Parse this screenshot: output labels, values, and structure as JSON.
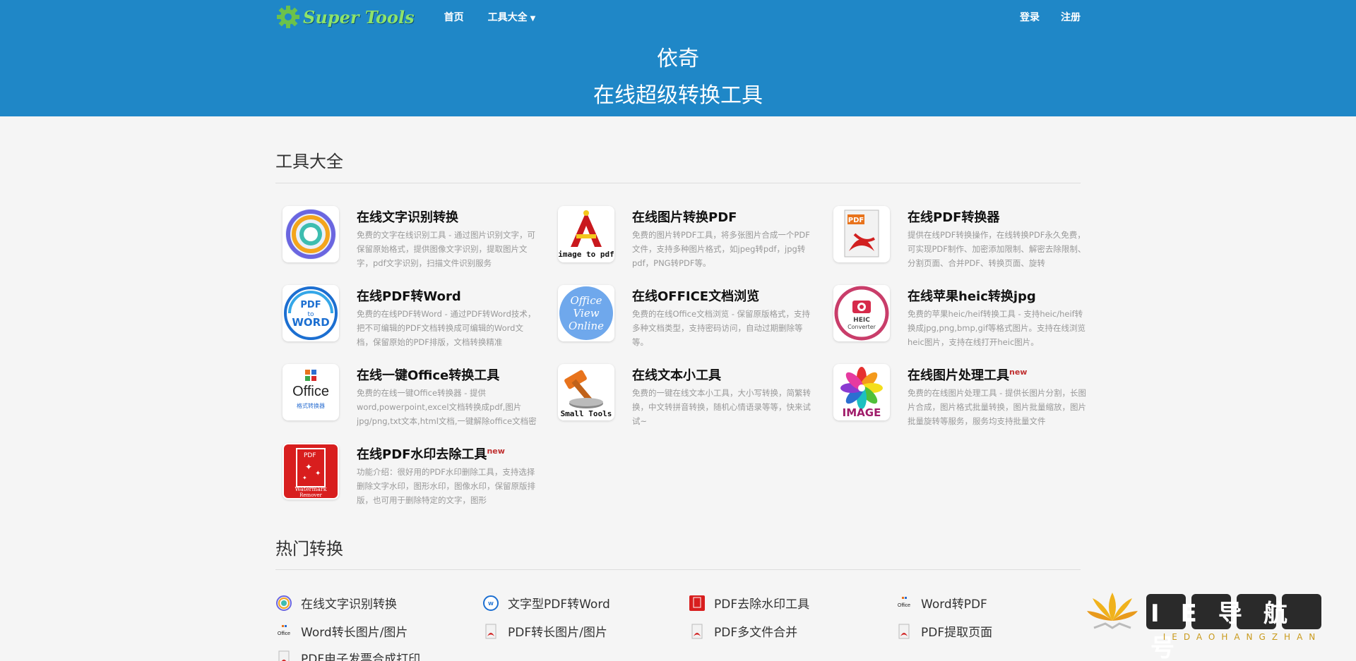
{
  "nav": {
    "brand": "Super Tools",
    "home": "首页",
    "tools_menu": "工具大全",
    "login": "登录",
    "register": "注册"
  },
  "hero": {
    "line1": "依奇",
    "line2": "在线超级转换工具"
  },
  "tools_section": {
    "title": "工具大全",
    "items": [
      {
        "title": "在线文字识别转换",
        "new": "",
        "icon": "ocr-icon",
        "desc": "免费的文字在线识别工具 - 通过图片识别文字，可保留原始格式，提供图像文字识别，提取图片文字，pdf文字识别，扫描文件识别服务"
      },
      {
        "title": "在线图片转换PDF",
        "new": "",
        "icon": "image-to-pdf-icon",
        "desc": "免费的图片转PDF工具，将多张图片合成一个PDF文件，支持多种图片格式，如jpeg转pdf，jpg转pdf，PNG转PDF等。"
      },
      {
        "title": "在线PDF转换器",
        "new": "",
        "icon": "pdf-converter-icon",
        "desc": "提供在线PDF转换操作，在线转换PDF永久免费，可实现PDF制作、加密添加限制、解密去除限制、分割页面、合并PDF、转换页面、旋转"
      },
      {
        "title": "在线PDF转Word",
        "new": "",
        "icon": "pdf-to-word-icon",
        "desc": "免费的在线PDF转Word - 通过PDF转Word技术，把不可编辑的PDF文档转换成可编辑的Word文档，保留原始的PDF排版，文档转换精准"
      },
      {
        "title": "在线OFFICE文档浏览",
        "new": "",
        "icon": "office-view-icon",
        "desc": "免费的在线Office文档浏览 - 保留原版格式，支持多种文档类型，支持密码访问，自动过期删除等等。"
      },
      {
        "title": "在线苹果heic转换jpg",
        "new": "",
        "icon": "heic-converter-icon",
        "desc": "免费的苹果heic/heif转换工具 - 支持heic/heif转换成jpg,png,bmp,gif等格式图片。支持在线浏览heic图片，支持在线打开heic图片。"
      },
      {
        "title": "在线一键Office转换工具",
        "new": "",
        "icon": "office-convert-icon",
        "desc": "免费的在线一键Office转换器 - 提供word,powerpoint,excel文档转换成pdf,图片jpg/png,txt文本,html文档,一键解除office文档密码"
      },
      {
        "title": "在线文本小工具",
        "new": "",
        "icon": "small-tools-icon",
        "desc": "免费的一键在线文本小工具，大小写转换，简繁转换，中文转拼音转换，随机心情语录等等，快来试试~"
      },
      {
        "title": "在线图片处理工具",
        "new": "new",
        "icon": "image-tools-icon",
        "desc": "免费的在线图片处理工具 - 提供长图片分割，长图片合成，图片格式批量转换，图片批量缩放，图片批量旋转等服务，服务均支持批量文件"
      },
      {
        "title": "在线PDF水印去除工具",
        "new": "new",
        "icon": "watermark-remover-icon",
        "desc": "功能介绍：很好用的PDF水印删除工具，支持选择删除文字水印，图形水印，图像水印，保留原版排版，也可用于删除特定的文字，图形"
      }
    ]
  },
  "hot_section": {
    "title": "热门转换",
    "items": [
      {
        "label": "在线文字识别转换",
        "icon": "ocr-icon"
      },
      {
        "label": "文字型PDF转Word",
        "icon": "pdf-to-word-icon"
      },
      {
        "label": "PDF去除水印工具",
        "icon": "watermark-remover-icon"
      },
      {
        "label": "Word转PDF",
        "icon": "office-icon"
      },
      {
        "label": "Word转长图片/图片",
        "icon": "office-icon"
      },
      {
        "label": "PDF转长图片/图片",
        "icon": "pdf-icon"
      },
      {
        "label": "PDF多文件合并",
        "icon": "pdf-icon"
      },
      {
        "label": "PDF提取页面",
        "icon": "pdf-icon"
      },
      {
        "label": "PDF电子发票合成打印",
        "icon": "pdf-icon"
      }
    ]
  },
  "watermark": {
    "title": "IE导航号",
    "subtitle": "IEDAOHANGZHAN"
  },
  "colors": {
    "header_blue": "#1f87c7",
    "brand_green": "#8de36a",
    "new_badge": "#c03030"
  }
}
